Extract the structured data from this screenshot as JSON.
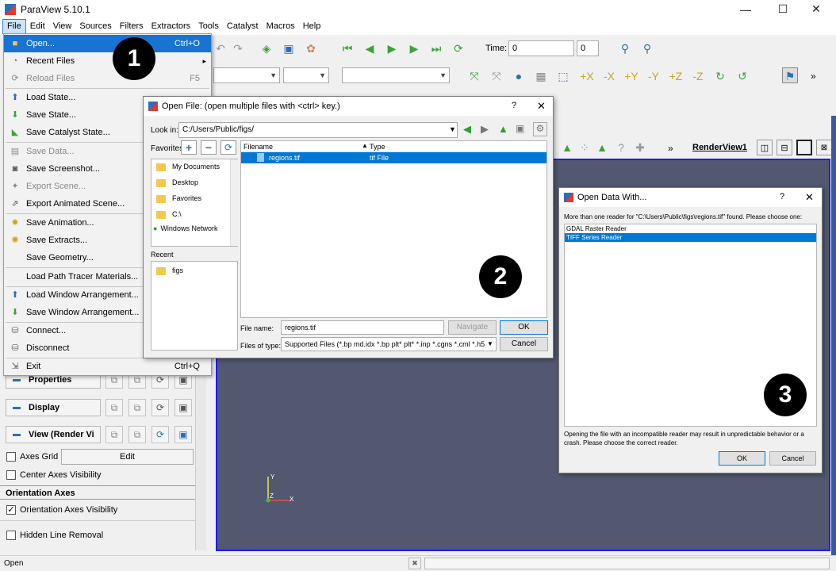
{
  "window": {
    "title": "ParaView 5.10.1",
    "minimize": "—",
    "maximize": "☐",
    "close": "✕"
  },
  "menubar": [
    "File",
    "Edit",
    "View",
    "Sources",
    "Filters",
    "Extractors",
    "Tools",
    "Catalyst",
    "Macros",
    "Help"
  ],
  "toolbar": {
    "time_label": "Time:",
    "time_value": "0",
    "time_step": "0"
  },
  "file_menu": [
    {
      "label": "Open...",
      "shortcut": "Ctrl+O",
      "state": "highlighted"
    },
    {
      "label": "Recent Files",
      "shortcut": "▸",
      "state": "normal"
    },
    {
      "label": "Reload Files",
      "shortcut": "F5",
      "state": "disabled"
    },
    {
      "label": "Load State...",
      "shortcut": "",
      "state": "normal"
    },
    {
      "label": "Save State...",
      "shortcut": "",
      "state": "normal"
    },
    {
      "label": "Save Catalyst State...",
      "shortcut": "",
      "state": "normal"
    },
    {
      "label": "Save Data...",
      "shortcut": "",
      "state": "disabled"
    },
    {
      "label": "Save Screenshot...",
      "shortcut": "",
      "state": "normal"
    },
    {
      "label": "Export Scene...",
      "shortcut": "",
      "state": "disabled"
    },
    {
      "label": "Export Animated Scene...",
      "shortcut": "",
      "state": "normal"
    },
    {
      "label": "Save Animation...",
      "shortcut": "",
      "state": "normal"
    },
    {
      "label": "Save Extracts...",
      "shortcut": "",
      "state": "normal"
    },
    {
      "label": "Save Geometry...",
      "shortcut": "",
      "state": "normal"
    },
    {
      "label": "Load Path Tracer Materials...",
      "shortcut": "",
      "state": "normal"
    },
    {
      "label": "Load Window Arrangement...",
      "shortcut": "",
      "state": "normal"
    },
    {
      "label": "Save Window Arrangement...",
      "shortcut": "",
      "state": "normal"
    },
    {
      "label": "Connect...",
      "shortcut": "",
      "state": "normal"
    },
    {
      "label": "Disconnect",
      "shortcut": "",
      "state": "normal"
    },
    {
      "label": "Exit",
      "shortcut": "Ctrl+Q",
      "state": "normal"
    }
  ],
  "left_panel": {
    "properties": "Properties",
    "display": "Display",
    "view": "View (Render Vi",
    "axes_grid": "Axes Grid",
    "edit": "Edit",
    "center_axes": "Center Axes Visibility",
    "orientation_header": "Orientation Axes",
    "orientation_vis": "Orientation Axes Visibility",
    "hidden_line": "Hidden Line Removal"
  },
  "render_view": {
    "name": "RenderView1"
  },
  "open_file": {
    "title": "Open File:  (open multiple files with <ctrl> key.)",
    "help": "?",
    "close": "✕",
    "look_in_label": "Look in:",
    "look_in_value": "C:/Users/Public/figs/",
    "favorites_label": "Favorites",
    "favorites": [
      "My Documents",
      "Desktop",
      "Favorites",
      "C:\\",
      "Windows Network"
    ],
    "recent_label": "Recent",
    "recent": [
      "figs"
    ],
    "columns": [
      "Filename",
      "Type"
    ],
    "files": [
      {
        "name": "regions.tif",
        "type": "tif File"
      }
    ],
    "filename_label": "File name:",
    "filename_value": "regions.tif",
    "filetype_label": "Files of type:",
    "filetype_value": "Supported Files (*.bp md.idx *.bp plt* plt* *.inp *.cgns *.cml *.h5",
    "navigate": "Navigate",
    "ok": "OK",
    "cancel": "Cancel"
  },
  "open_with": {
    "title": "Open Data With...",
    "help": "?",
    "close": "✕",
    "message": "More than one reader for \"C:\\Users\\Public\\figs\\regions.tif\" found. Please choose one:",
    "readers": [
      "GDAL Raster Reader",
      "TIFF Series Reader"
    ],
    "selected": 1,
    "warning": "Opening the file with an incompatible reader may result in unpredictable behavior or a crash.  Please choose the correct reader.",
    "ok": "OK",
    "cancel": "Cancel"
  },
  "badges": [
    "1",
    "2",
    "3"
  ],
  "status": {
    "text": "Open",
    "close": "✖"
  },
  "colors": {
    "accent": "#0078d7",
    "render_bg": "#525870",
    "render_border": "#1a1aff",
    "menu_highlight": "#1873d3"
  }
}
